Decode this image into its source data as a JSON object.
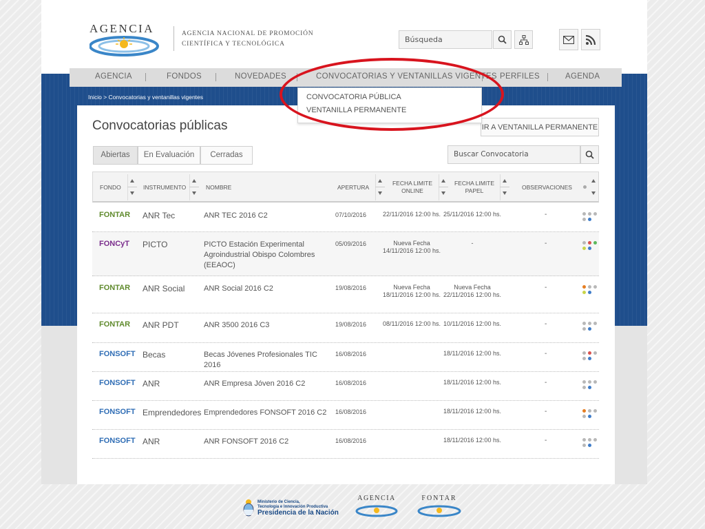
{
  "header": {
    "logo_text": "AGENCIA",
    "agency_name_line1": "AGENCIA NACIONAL DE PROMOCIÓN",
    "agency_name_line2": "CIENTÍFICA Y TECNOLÓGICA",
    "search_placeholder": "Búsqueda",
    "icons": [
      "search-icon",
      "sitemap-icon",
      "mail-icon",
      "rss-icon"
    ]
  },
  "nav": {
    "items": [
      "AGENCIA",
      "FONDOS",
      "NOVEDADES",
      "CONVOCATORIAS Y VENTANILLAS VIGENTES",
      "PERFILES",
      "AGENDA"
    ],
    "dropdown": [
      "CONVOCATORIA PÚBLICA",
      "VENTANILLA PERMANENTE"
    ]
  },
  "breadcrumb": "Inicio > Convocatorias y ventanillas vigentes",
  "page": {
    "title": "Convocatorias públicas",
    "ventanilla_button": "IR A VENTANILLA PERMANENTE",
    "tabs": [
      "Abiertas",
      "En Evaluación",
      "Cerradas"
    ],
    "active_tab": "Abiertas",
    "search_placeholder": "Buscar Convocatoria"
  },
  "table": {
    "headers": {
      "fondo": "FONDO",
      "instrumento": "INSTRUMENTO",
      "nombre": "NOMBRE",
      "apertura": "APERTURA",
      "online_line1": "FECHA LIMITE",
      "online_line2": "ONLINE",
      "papel_line1": "FECHA LIMITE",
      "papel_line2": "PAPEL",
      "observaciones": "OBSERVACIONES"
    },
    "rows": [
      {
        "fondo": "FONTAR",
        "instrumento": "ANR Tec",
        "nombre": "ANR TEC 2016 C2",
        "apertura": "07/10/2016",
        "online": "22/11/2016 12:00 hs.",
        "papel": "25/11/2016 12:00 hs.",
        "obs": "-"
      },
      {
        "fondo": "FONCyT",
        "instrumento": "PICTO",
        "nombre": "PICTO Estación Experimental Agroindustrial Obispo Colombres (EEAOC)",
        "apertura": "05/09/2016",
        "online": "Nueva Fecha 14/11/2016 12:00 hs.",
        "papel": "-",
        "obs": "-"
      },
      {
        "fondo": "FONTAR",
        "instrumento": "ANR Social",
        "nombre": "ANR Social 2016 C2",
        "apertura": "19/08/2016",
        "online": "Nueva Fecha 18/11/2016 12:00 hs.",
        "papel": "Nueva Fecha 22/11/2016 12:00 hs.",
        "obs": "-"
      },
      {
        "fondo": "FONTAR",
        "instrumento": "ANR PDT",
        "nombre": "ANR 3500 2016 C3",
        "apertura": "19/08/2016",
        "online": "08/11/2016 12:00 hs.",
        "papel": "10/11/2016 12:00 hs.",
        "obs": "-"
      },
      {
        "fondo": "FONSOFT",
        "instrumento": "Becas",
        "nombre": "Becas Jóvenes Profesionales TIC 2016",
        "apertura": "16/08/2016",
        "online": "",
        "papel": "18/11/2016 12:00 hs.",
        "obs": "-"
      },
      {
        "fondo": "FONSOFT",
        "instrumento": "ANR",
        "nombre": "ANR Empresa Jóven 2016 C2",
        "apertura": "16/08/2016",
        "online": "",
        "papel": "18/11/2016 12:00 hs.",
        "obs": "-"
      },
      {
        "fondo": "FONSOFT",
        "instrumento": "Emprendedores",
        "nombre": "Emprendedores FONSOFT 2016 C2",
        "apertura": "16/08/2016",
        "online": "",
        "papel": "18/11/2016 12:00 hs.",
        "obs": "-"
      },
      {
        "fondo": "FONSOFT",
        "instrumento": "ANR",
        "nombre": "ANR FONSOFT 2016 C2",
        "apertura": "16/08/2016",
        "online": "",
        "papel": "18/11/2016 12:00 hs.",
        "obs": "-"
      }
    ]
  },
  "footer": {
    "ministry_line1": "Ministerio de Ciencia,",
    "ministry_line2": "Tecnología e Innovación Productiva",
    "ministry_line3": "Presidencia de la Nación",
    "agencia": "AGENCIA",
    "fontar": "FONTAR"
  },
  "colors": {
    "fontar": "#5f8a2c",
    "foncyt": "#7a2d8c",
    "fonsoft": "#2f6db5",
    "band": "#1f4e8c",
    "highlight": "#d8141e"
  }
}
